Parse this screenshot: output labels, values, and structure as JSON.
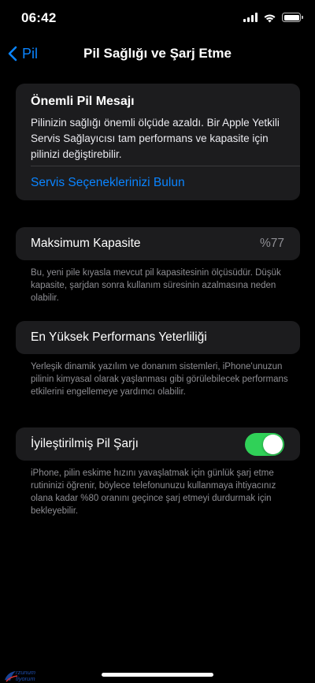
{
  "status_bar": {
    "time": "06:42",
    "icons": [
      "cellular-signal-icon",
      "wifi-icon",
      "battery-icon"
    ],
    "battery_level": 1.0
  },
  "nav": {
    "back_label": "Pil",
    "title": "Pil Sağlığı ve Şarj Etme"
  },
  "message": {
    "title": "Önemli Pil Mesajı",
    "body": "Pilinizin sağlığı önemli ölçüde azaldı. Bir Apple Yetkili Servis Sağlayıcısı tam performans ve kapasite için pilinizi değiştirebilir.",
    "link": "Servis Seçeneklerinizi Bulun"
  },
  "max_capacity": {
    "label": "Maksimum Kapasite",
    "value": "%77",
    "footnote": "Bu, yeni pile kıyasla mevcut pil kapasitesinin ölçüsüdür. Düşük kapasite, şarjdan sonra kullanım süresinin azalmasına neden olabilir."
  },
  "peak_performance": {
    "label": "En Yüksek Performans Yeterliliği",
    "footnote": "Yerleşik dinamik yazılım ve donanım sistemleri, iPhone'unuzun pilinin kimyasal olarak yaşlanması gibi görülebilecek performans etkilerini engellemeye yardımcı olabilir."
  },
  "optimized_charging": {
    "label": "İyileştirilmiş Pil Şarjı",
    "enabled": true,
    "footnote": "iPhone, pilin eskime hızını yavaşlatmak için günlük şarj etme rutininizi öğrenir, böylece telefonunuzu kullanmaya ihtiyacınız olana kadar %80 oranını geçince şarj etmeyi durdurmak için bekleyebilir."
  },
  "watermark": {
    "text_line1": "rzunum",
    "text_line2": "tiyorum"
  },
  "colors": {
    "background": "#000000",
    "card": "#1c1c1e",
    "accent": "#0a84ff",
    "toggle_on": "#30d158",
    "secondary_text": "#8e8e93"
  }
}
